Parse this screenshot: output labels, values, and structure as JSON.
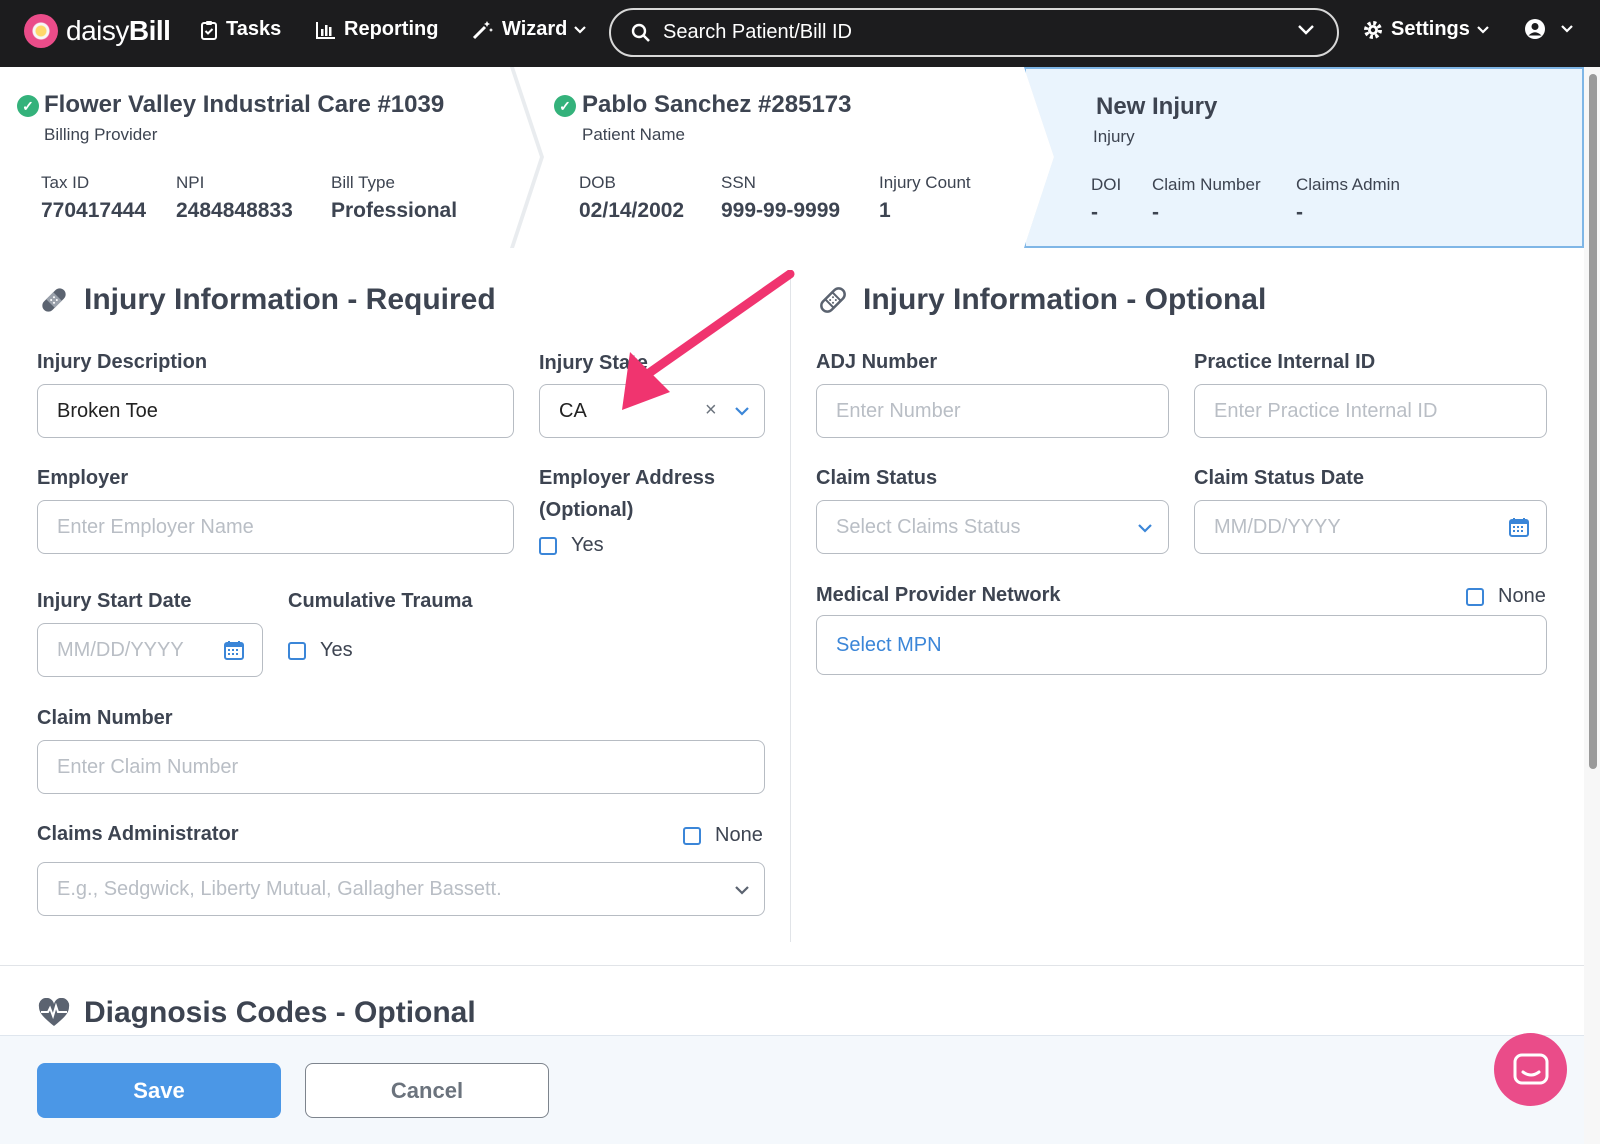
{
  "nav": {
    "brand_light": "daisy",
    "brand_bold": "Bill",
    "tasks": "Tasks",
    "reporting": "Reporting",
    "wizard": "Wizard",
    "search_placeholder": "Search Patient/Bill ID",
    "settings": "Settings"
  },
  "provider": {
    "title": "Flower Valley Industrial Care #1039",
    "subtitle": "Billing Provider",
    "tax_id_label": "Tax ID",
    "tax_id": "770417444",
    "npi_label": "NPI",
    "npi": "2484848833",
    "bill_type_label": "Bill Type",
    "bill_type": "Professional"
  },
  "patient": {
    "title": "Pablo Sanchez #285173",
    "subtitle": "Patient Name",
    "dob_label": "DOB",
    "dob": "02/14/2002",
    "ssn_label": "SSN",
    "ssn": "999-99-9999",
    "injury_count_label": "Injury Count",
    "injury_count": "1"
  },
  "injury_header": {
    "title": "New Injury",
    "subtitle": "Injury",
    "doi_label": "DOI",
    "doi": "-",
    "claim_number_label": "Claim Number",
    "claim_number": "-",
    "claims_admin_label": "Claims Admin",
    "claims_admin": "-"
  },
  "required": {
    "title": "Injury Information - Required",
    "description_label": "Injury Description",
    "description_value": "Broken Toe",
    "state_label": "Injury State",
    "state_value": "CA",
    "employer_label": "Employer",
    "employer_placeholder": "Enter Employer Name",
    "employer_address_label_1": "Employer Address",
    "employer_address_label_2": "(Optional)",
    "employer_address_cb": "Yes",
    "start_date_label": "Injury Start Date",
    "start_date_placeholder": "MM/DD/YYYY",
    "cumulative_label": "Cumulative Trauma",
    "cumulative_cb": "Yes",
    "claim_number_label": "Claim Number",
    "claim_number_placeholder": "Enter Claim Number",
    "claims_admin_label": "Claims Administrator",
    "claims_admin_none": "None",
    "claims_admin_placeholder": "E.g., Sedgwick, Liberty Mutual, Gallagher Bassett."
  },
  "optional": {
    "title": "Injury Information - Optional",
    "adj_label": "ADJ Number",
    "adj_placeholder": "Enter Number",
    "internal_id_label": "Practice Internal ID",
    "internal_id_placeholder": "Enter Practice Internal ID",
    "claim_status_label": "Claim Status",
    "claim_status_placeholder": "Select Claims Status",
    "claim_status_date_label": "Claim Status Date",
    "claim_status_date_placeholder": "MM/DD/YYYY",
    "mpn_label": "Medical Provider Network",
    "mpn_none": "None",
    "mpn_value": "Select MPN"
  },
  "diagnosis": {
    "title": "Diagnosis Codes - Optional"
  },
  "footer": {
    "save": "Save",
    "cancel": "Cancel"
  },
  "colors": {
    "nav_bg": "#1c1c1e",
    "accent": "#4b97e6",
    "annotation_arrow": "#f0346f",
    "success": "#34b27b",
    "chat": "#ea4c89"
  }
}
